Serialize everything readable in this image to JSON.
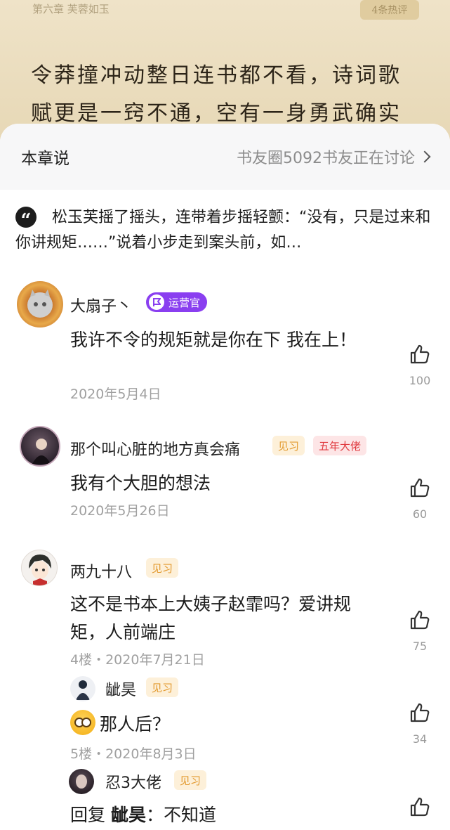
{
  "reader": {
    "chapter_title": "第六章 芙蓉如玉",
    "hot_comments": "4条热评",
    "line1": "令莽撞冲动整日连书都不看，诗词歌",
    "line2": "赋更是一窍不通，空有一身勇武确实"
  },
  "sheet": {
    "title": "本章说",
    "discuss_link": "书友圈5092书友正在讨论",
    "quote": "松玉芙摇了摇头，连带着步摇轻颤：“没有，只是过来和你讲规矩……”说着小步走到案头前，如…"
  },
  "comments": [
    {
      "user": "大扇子丶",
      "badges": [
        "运营官"
      ],
      "text": "我许不令的规矩就是你在下 我在上！",
      "meta": "2020年5月4日",
      "likes": "100"
    },
    {
      "user": "那个叫心脏的地方真会痛",
      "badges": [
        "见习",
        "五年大佬"
      ],
      "text": "我有个大胆的想法",
      "meta": "2020年5月26日",
      "likes": "60"
    },
    {
      "user": "两九十八",
      "badges": [
        "见习"
      ],
      "text": "这不是书本上大姨子赵霏吗？爱讲规矩，人前端庄",
      "meta": "4楼・2020年7月21日",
      "likes": "75"
    },
    {
      "user": "龇昊",
      "badges": [
        "见习"
      ],
      "text": "那人后？",
      "meta": "5楼・2020年8月3日",
      "likes": "34"
    },
    {
      "user": "忍3大佬",
      "badges": [
        "见习"
      ],
      "reply_prefix": "回复",
      "reply_to": "龇昊",
      "reply_text": "：不知道",
      "likes": ""
    }
  ],
  "colors": {
    "accent_purple": "#8a3ff0",
    "badge_intern": "#e39a2f",
    "badge_veteran": "#e0393e",
    "reader_bg": "#e9dcc0"
  },
  "icons": {
    "quote": "quote-icon",
    "like": "thumbs-up-icon",
    "chevron": "chevron-right-icon"
  }
}
